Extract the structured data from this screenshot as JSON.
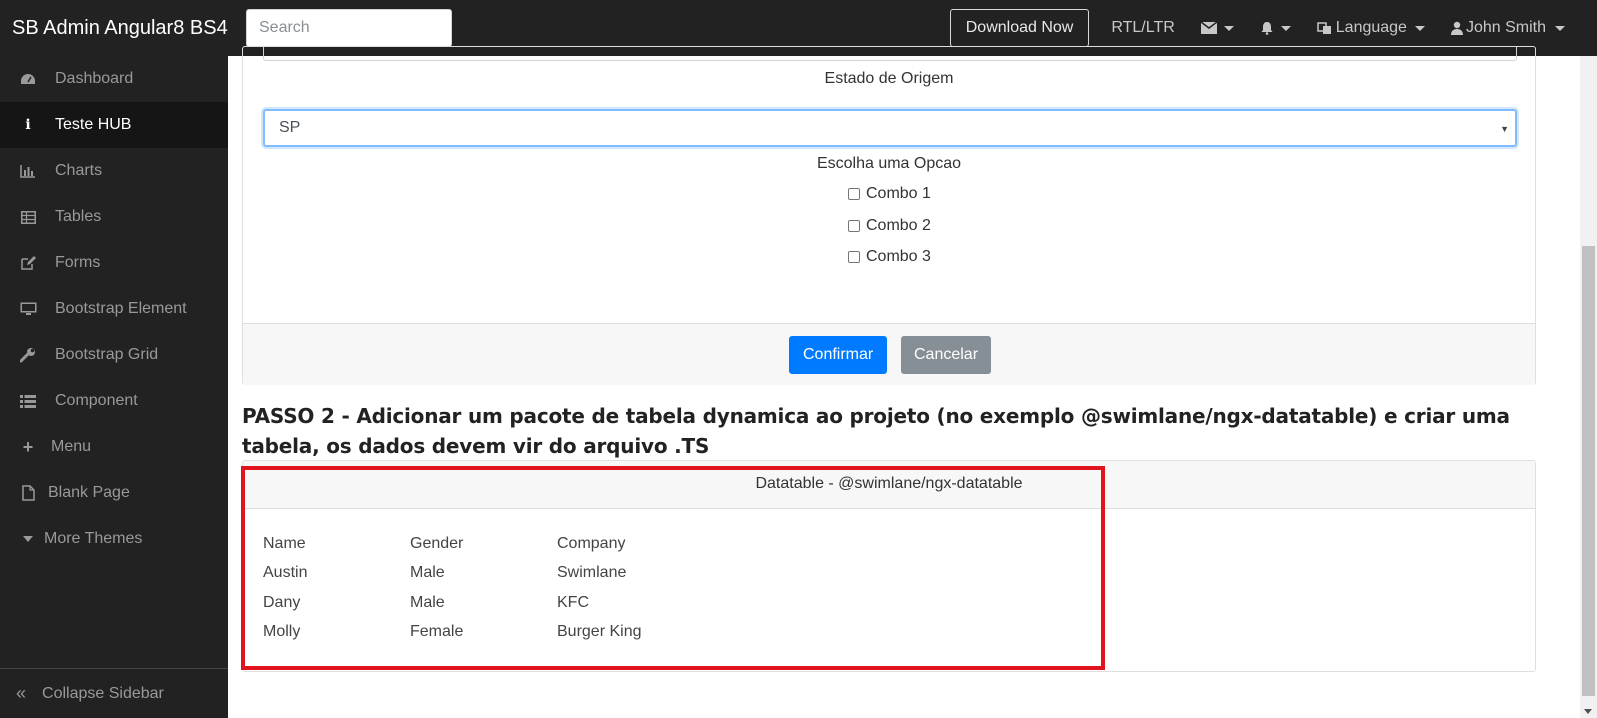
{
  "brand": "SB Admin Angular8 BS4",
  "search": {
    "placeholder": "Search"
  },
  "navbar": {
    "download_label": "Download Now",
    "rtl_label": "RTL/LTR",
    "language_label": "Language",
    "user_label": "John Smith"
  },
  "sidebar": {
    "items": [
      {
        "label": "Dashboard",
        "icon": "dashboard-icon"
      },
      {
        "label": "Teste HUB",
        "icon": "info-icon",
        "active": true
      },
      {
        "label": "Charts",
        "icon": "bar-chart-icon"
      },
      {
        "label": "Tables",
        "icon": "table-icon"
      },
      {
        "label": "Forms",
        "icon": "edit-icon"
      },
      {
        "label": "Bootstrap Element",
        "icon": "desktop-icon"
      },
      {
        "label": "Bootstrap Grid",
        "icon": "wrench-icon"
      },
      {
        "label": "Component",
        "icon": "list-icon"
      },
      {
        "label": "Menu",
        "icon": "plus-icon"
      },
      {
        "label": "Blank Page",
        "icon": "file-icon"
      },
      {
        "label": "More Themes",
        "icon": "caret-down-icon"
      }
    ],
    "collapse_label": "Collapse Sidebar"
  },
  "form": {
    "estado_label": "Estado de Origem",
    "estado_value": "SP",
    "opcao_label": "Escolha uma Opcao",
    "options": [
      "Combo 1",
      "Combo 2",
      "Combo 3"
    ],
    "confirm_label": "Confirmar",
    "cancel_label": "Cancelar"
  },
  "step2": {
    "title": "PASSO 2 - Adicionar um pacote de tabela dynamica ao projeto (no exemplo @swimlane/ngx-datatable) e criar uma tabela, os dados devem vir do arquivo .TS"
  },
  "datatable": {
    "title": "Datatable - @swimlane/ngx-datatable",
    "columns": [
      "Name",
      "Gender",
      "Company"
    ],
    "rows": [
      [
        "Austin",
        "Male",
        "Swimlane"
      ],
      [
        "Dany",
        "Male",
        "KFC"
      ],
      [
        "Molly",
        "Female",
        "Burger King"
      ]
    ]
  },
  "colors": {
    "navbar_bg": "#222222",
    "primary": "#007bff",
    "secondary": "#868e96",
    "highlight": "#e0141e"
  }
}
